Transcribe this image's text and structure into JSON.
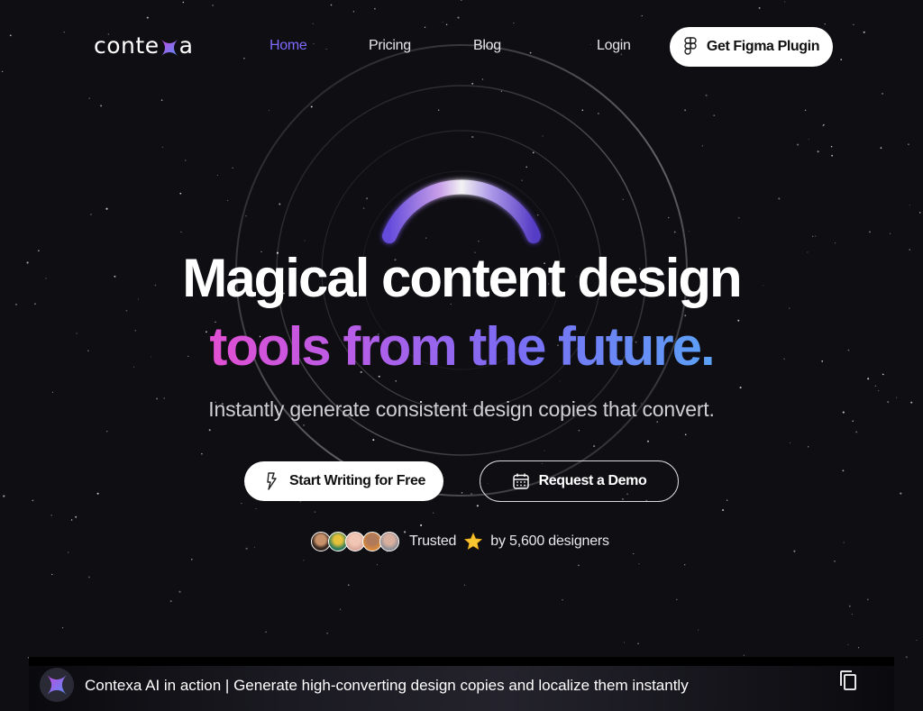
{
  "brand": {
    "logo_prefix": "conte",
    "logo_suffix": "a"
  },
  "nav": {
    "home": "Home",
    "pricing": "Pricing",
    "blog": "Blog",
    "login": "Login",
    "cta": "Get Figma Plugin"
  },
  "hero": {
    "headline_line1": "Magical content design",
    "headline_line2": "tools from the future.",
    "subtitle": "Instantly generate consistent design copies that convert.",
    "primary_button": "Start Writing for Free",
    "secondary_button": "Request a Demo"
  },
  "trusted": {
    "label": "Trusted",
    "count_text": "by 5,600 designers"
  },
  "video": {
    "title": "Contexa AI in action | Generate high-converting design copies and localize them instantly"
  },
  "colors": {
    "background": "#0f0e13",
    "nav_active": "#7d6bff",
    "gradient_start": "#e24fd2",
    "gradient_end": "#5ba2f6"
  },
  "icons": {
    "logo_mark": "x-star-mark-icon",
    "figma": "figma-icon",
    "primary_button": "bolt-icon",
    "secondary_button": "calendar-icon",
    "rating": "star-icon",
    "video_action": "copy-icon"
  }
}
